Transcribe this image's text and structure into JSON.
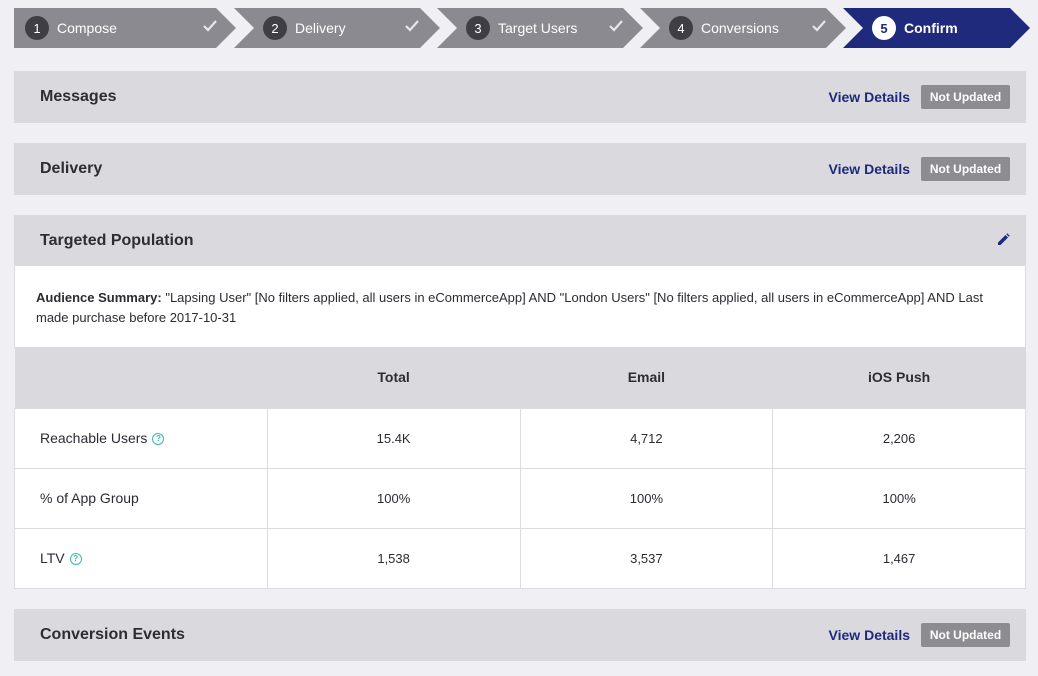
{
  "stepper": {
    "steps": [
      {
        "number": "1",
        "label": "Compose",
        "state": "complete"
      },
      {
        "number": "2",
        "label": "Delivery",
        "state": "complete"
      },
      {
        "number": "3",
        "label": "Target Users",
        "state": "complete"
      },
      {
        "number": "4",
        "label": "Conversions",
        "state": "complete"
      },
      {
        "number": "5",
        "label": "Confirm",
        "state": "active"
      }
    ],
    "colors": {
      "complete": "#8a8a90",
      "active": "#1f2a7c"
    }
  },
  "panels": {
    "messages": {
      "title": "Messages",
      "link": "View Details",
      "status": "Not Updated"
    },
    "delivery": {
      "title": "Delivery",
      "link": "View Details",
      "status": "Not Updated"
    },
    "targeted_population": {
      "title": "Targeted Population",
      "edit_icon": "pencil-icon"
    },
    "conversion_events": {
      "title": "Conversion Events",
      "link": "View Details",
      "status": "Not Updated"
    }
  },
  "audience_summary": {
    "label": "Audience Summary:",
    "text": "\"Lapsing User\" [No filters applied, all users in eCommerceApp] AND \"London Users\" [No filters applied, all users in eCommerceApp] AND Last made purchase before 2017-10-31"
  },
  "stats_table": {
    "columns": [
      "",
      "Total",
      "Email",
      "iOS Push"
    ],
    "rows": [
      {
        "label": "Reachable Users",
        "help": "?",
        "values": [
          "15.4K",
          "4,712",
          "2,206"
        ]
      },
      {
        "label": "% of App Group",
        "help": "",
        "values": [
          "100%",
          "100%",
          "100%"
        ]
      },
      {
        "label": "LTV",
        "help": "?",
        "values": [
          "1,538",
          "3,537",
          "1,467"
        ]
      }
    ]
  },
  "colors": {
    "accent": "#1f2a7c",
    "badge": "#8c8c91",
    "help": "#3ab7b0"
  }
}
